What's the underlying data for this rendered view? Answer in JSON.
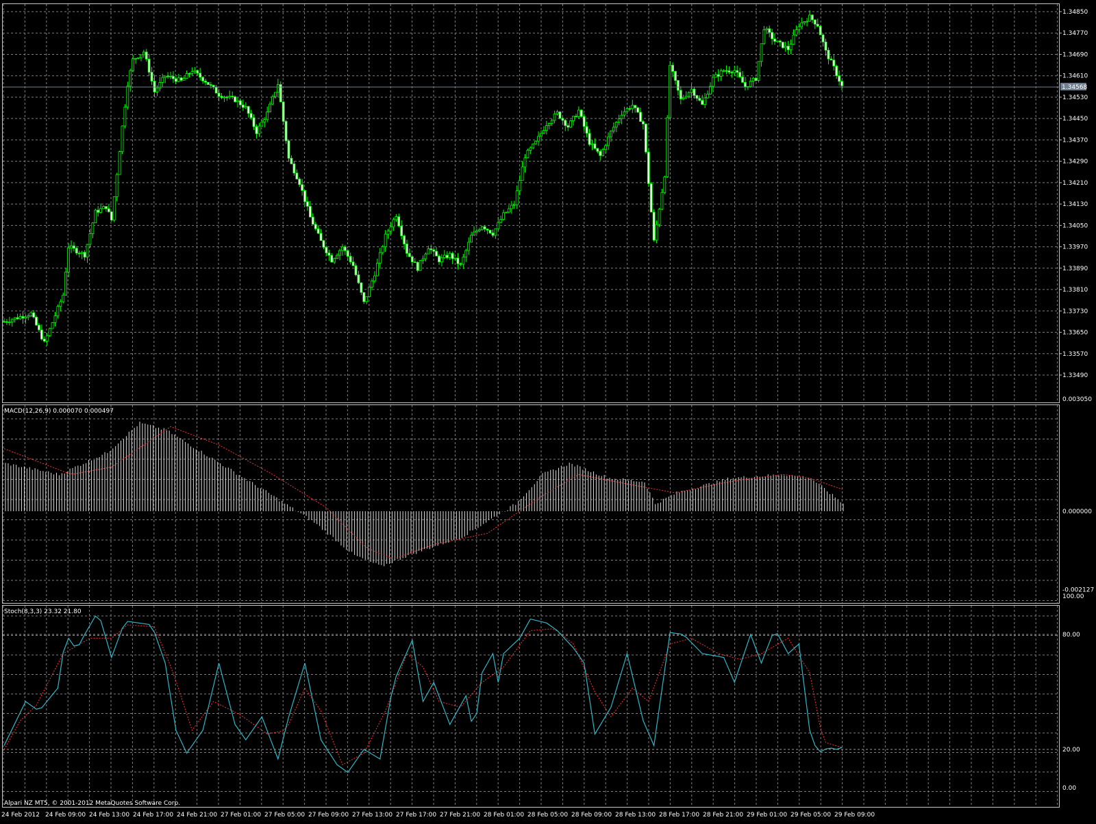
{
  "colors": {
    "background": "#000000",
    "grid": "#7f7f7f",
    "frame": "#c8c8c8",
    "candle": "#00ff00",
    "candle_body_up": "#000000",
    "candle_body_down": "#e8ffe0",
    "macd_hist": "#e0e0e0",
    "signal": "#ff3030",
    "stoch_main": "#2fb7c8",
    "current_price_line": "#708090",
    "current_price_tag": "#708090"
  },
  "main_chart": {
    "current_price": "1.34568",
    "price_ticks": [
      "1.34850",
      "1.34770",
      "1.34690",
      "1.34610",
      "1.34530",
      "1.34450",
      "1.34370",
      "1.34290",
      "1.34210",
      "1.34130",
      "1.34050",
      "1.33970",
      "1.33890",
      "1.33810",
      "1.33730",
      "1.33650",
      "1.33570",
      "1.33490"
    ]
  },
  "macd_panel": {
    "label": "MACD(12,26,9) 0.000070 0.000497",
    "ticks": [
      "0.003050",
      "0.000000",
      "-0.002127"
    ]
  },
  "stoch_panel": {
    "label": "Stoch(8,3,3) 23.32 21.80",
    "ticks": [
      "100.00",
      "80.00",
      "20.00",
      "0.00"
    ]
  },
  "footer": {
    "copyright": "Alpari NZ MT5, © 2001-2012 MetaQuotes Software Corp.",
    "time_labels": [
      "24 Feb 2012",
      "24 Feb 09:00",
      "24 Feb 13:00",
      "24 Feb 17:00",
      "24 Feb 21:00",
      "27 Feb 01:00",
      "27 Feb 05:00",
      "27 Feb 09:00",
      "27 Feb 13:00",
      "27 Feb 17:00",
      "27 Feb 21:00",
      "28 Feb 01:00",
      "28 Feb 05:00",
      "28 Feb 09:00",
      "28 Feb 13:00",
      "28 Feb 17:00",
      "28 Feb 21:00",
      "29 Feb 01:00",
      "29 Feb 05:00",
      "29 Feb 09:00"
    ]
  },
  "chart_data": {
    "type": "candlestick",
    "timeframe_step": "15 min",
    "start": "24 Feb 2012 05:00",
    "y_range": [
      1.3343,
      1.3489
    ],
    "close_path": [
      [
        0,
        1.3369
      ],
      [
        10,
        1.3372
      ],
      [
        15,
        1.3361
      ],
      [
        22,
        1.3379
      ],
      [
        24,
        1.3397
      ],
      [
        30,
        1.3394
      ],
      [
        34,
        1.341
      ],
      [
        38,
        1.3412
      ],
      [
        40,
        1.3407
      ],
      [
        44,
        1.3442
      ],
      [
        46,
        1.3458
      ],
      [
        48,
        1.3467
      ],
      [
        52,
        1.347
      ],
      [
        54,
        1.3463
      ],
      [
        56,
        1.3455
      ],
      [
        60,
        1.3461
      ],
      [
        66,
        1.3459
      ],
      [
        70,
        1.3463
      ],
      [
        75,
        1.3459
      ],
      [
        80,
        1.3454
      ],
      [
        86,
        1.3452
      ],
      [
        90,
        1.3449
      ],
      [
        94,
        1.344
      ],
      [
        98,
        1.3447
      ],
      [
        102,
        1.3458
      ],
      [
        106,
        1.343
      ],
      [
        110,
        1.3421
      ],
      [
        114,
        1.3408
      ],
      [
        118,
        1.3399
      ],
      [
        122,
        1.3392
      ],
      [
        126,
        1.3397
      ],
      [
        130,
        1.339
      ],
      [
        134,
        1.3376
      ],
      [
        138,
        1.3387
      ],
      [
        142,
        1.3401
      ],
      [
        146,
        1.3409
      ],
      [
        150,
        1.3395
      ],
      [
        154,
        1.3389
      ],
      [
        158,
        1.3397
      ],
      [
        162,
        1.3392
      ],
      [
        166,
        1.3394
      ],
      [
        170,
        1.339
      ],
      [
        174,
        1.3401
      ],
      [
        178,
        1.3405
      ],
      [
        182,
        1.3402
      ],
      [
        186,
        1.3409
      ],
      [
        190,
        1.3413
      ],
      [
        194,
        1.3431
      ],
      [
        198,
        1.3436
      ],
      [
        202,
        1.3443
      ],
      [
        206,
        1.3447
      ],
      [
        210,
        1.3442
      ],
      [
        214,
        1.3448
      ],
      [
        218,
        1.3436
      ],
      [
        222,
        1.3431
      ],
      [
        226,
        1.344
      ],
      [
        230,
        1.3447
      ],
      [
        234,
        1.345
      ],
      [
        238,
        1.3443
      ],
      [
        242,
        1.3399
      ],
      [
        246,
        1.3424
      ],
      [
        248,
        1.3465
      ],
      [
        252,
        1.3452
      ],
      [
        256,
        1.3456
      ],
      [
        260,
        1.345
      ],
      [
        264,
        1.346
      ],
      [
        268,
        1.3463
      ],
      [
        272,
        1.3463
      ],
      [
        276,
        1.3457
      ],
      [
        280,
        1.346
      ],
      [
        283,
        1.3479
      ],
      [
        287,
        1.3474
      ],
      [
        292,
        1.3471
      ],
      [
        296,
        1.348
      ],
      [
        300,
        1.3483
      ],
      [
        303,
        1.348
      ],
      [
        306,
        1.347
      ],
      [
        309,
        1.3464
      ],
      [
        312,
        1.3457
      ]
    ],
    "macd_histogram_path": [
      [
        0,
        0.0013
      ],
      [
        20,
        0.001
      ],
      [
        38,
        0.0016
      ],
      [
        50,
        0.0024
      ],
      [
        60,
        0.0022
      ],
      [
        80,
        0.0013
      ],
      [
        100,
        0.0004
      ],
      [
        115,
        -0.0003
      ],
      [
        130,
        -0.0012
      ],
      [
        140,
        -0.0015
      ],
      [
        150,
        -0.0012
      ],
      [
        170,
        -0.0007
      ],
      [
        190,
        0.0002
      ],
      [
        200,
        0.001
      ],
      [
        210,
        0.0013
      ],
      [
        225,
        0.0009
      ],
      [
        238,
        0.0008
      ],
      [
        242,
        0.0002
      ],
      [
        250,
        0.0005
      ],
      [
        270,
        0.0009
      ],
      [
        290,
        0.001
      ],
      [
        300,
        0.0009
      ],
      [
        312,
        0.0002
      ]
    ],
    "macd_signal_path": [
      [
        0,
        0.0017
      ],
      [
        25,
        0.001
      ],
      [
        40,
        0.0012
      ],
      [
        62,
        0.0023
      ],
      [
        80,
        0.0018
      ],
      [
        100,
        0.001
      ],
      [
        120,
        0.0001
      ],
      [
        135,
        -0.001
      ],
      [
        145,
        -0.0013
      ],
      [
        160,
        -0.0009
      ],
      [
        180,
        -0.0006
      ],
      [
        200,
        0.0004
      ],
      [
        214,
        0.001
      ],
      [
        235,
        0.0007
      ],
      [
        250,
        0.0005
      ],
      [
        270,
        0.0008
      ],
      [
        290,
        0.001
      ],
      [
        300,
        0.0009
      ],
      [
        312,
        0.0006
      ]
    ],
    "stoch_main_path": [
      [
        0,
        22
      ],
      [
        8,
        45
      ],
      [
        13,
        40
      ],
      [
        20,
        52
      ],
      [
        23,
        80
      ],
      [
        27,
        72
      ],
      [
        30,
        80
      ],
      [
        35,
        92
      ],
      [
        40,
        68
      ],
      [
        45,
        87
      ],
      [
        55,
        85
      ],
      [
        60,
        65
      ],
      [
        64,
        30
      ],
      [
        68,
        18
      ],
      [
        74,
        30
      ],
      [
        80,
        65
      ],
      [
        86,
        33
      ],
      [
        90,
        25
      ],
      [
        96,
        37
      ],
      [
        102,
        15
      ],
      [
        106,
        37
      ],
      [
        112,
        65
      ],
      [
        118,
        25
      ],
      [
        124,
        12
      ],
      [
        128,
        8
      ],
      [
        134,
        20
      ],
      [
        140,
        15
      ],
      [
        145,
        55
      ],
      [
        152,
        77
      ],
      [
        156,
        45
      ],
      [
        160,
        55
      ],
      [
        166,
        33
      ],
      [
        172,
        48
      ],
      [
        175,
        28
      ],
      [
        178,
        60
      ],
      [
        182,
        70
      ],
      [
        184,
        55
      ],
      [
        186,
        70
      ],
      [
        192,
        78
      ],
      [
        196,
        88
      ],
      [
        202,
        86
      ],
      [
        206,
        82
      ],
      [
        212,
        73
      ],
      [
        216,
        65
      ],
      [
        220,
        28
      ],
      [
        226,
        42
      ],
      [
        232,
        70
      ],
      [
        238,
        35
      ],
      [
        242,
        22
      ],
      [
        248,
        81
      ],
      [
        253,
        80
      ],
      [
        260,
        70
      ],
      [
        268,
        68
      ],
      [
        272,
        55
      ],
      [
        278,
        80
      ],
      [
        282,
        65
      ],
      [
        287,
        83
      ],
      [
        292,
        70
      ],
      [
        296,
        75
      ],
      [
        300,
        30
      ],
      [
        303,
        18
      ],
      [
        307,
        21
      ],
      [
        310,
        20
      ],
      [
        312,
        21
      ]
    ],
    "stoch_signal_path": [
      [
        0,
        20
      ],
      [
        6,
        35
      ],
      [
        12,
        43
      ],
      [
        22,
        70
      ],
      [
        32,
        78
      ],
      [
        40,
        78
      ],
      [
        46,
        85
      ],
      [
        56,
        84
      ],
      [
        63,
        60
      ],
      [
        70,
        30
      ],
      [
        78,
        45
      ],
      [
        88,
        38
      ],
      [
        98,
        28
      ],
      [
        105,
        30
      ],
      [
        112,
        52
      ],
      [
        118,
        40
      ],
      [
        126,
        12
      ],
      [
        134,
        18
      ],
      [
        142,
        40
      ],
      [
        150,
        70
      ],
      [
        156,
        63
      ],
      [
        162,
        45
      ],
      [
        170,
        42
      ],
      [
        178,
        55
      ],
      [
        186,
        63
      ],
      [
        196,
        82
      ],
      [
        205,
        83
      ],
      [
        212,
        75
      ],
      [
        220,
        50
      ],
      [
        226,
        37
      ],
      [
        234,
        52
      ],
      [
        240,
        45
      ],
      [
        248,
        75
      ],
      [
        256,
        78
      ],
      [
        266,
        70
      ],
      [
        274,
        67
      ],
      [
        282,
        70
      ],
      [
        292,
        78
      ],
      [
        300,
        60
      ],
      [
        305,
        24
      ],
      [
        312,
        21
      ]
    ]
  }
}
